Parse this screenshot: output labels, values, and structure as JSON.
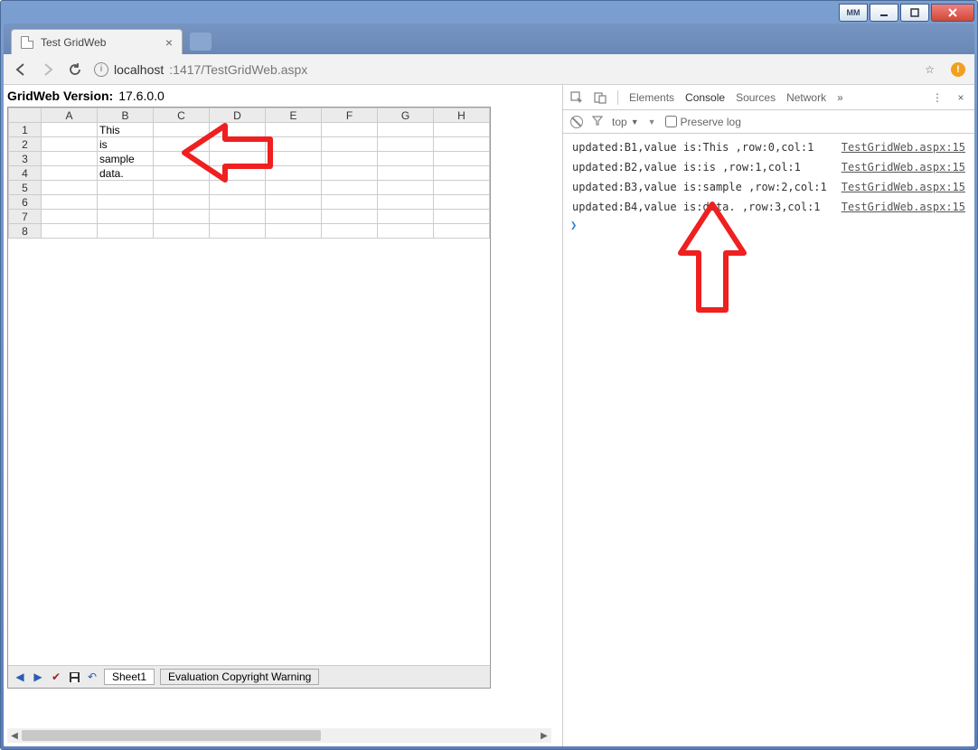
{
  "window": {
    "user_badge": "MM"
  },
  "browser": {
    "tab_title": "Test GridWeb",
    "url_host": "localhost",
    "url_port_path": ":1417/TestGridWeb.aspx"
  },
  "page": {
    "version_label": "GridWeb Version:",
    "version_value": "17.6.0.0"
  },
  "grid": {
    "columns": [
      "A",
      "B",
      "C",
      "D",
      "E",
      "F",
      "G",
      "H"
    ],
    "rows": [
      {
        "num": "1",
        "cells": [
          "",
          "This",
          "",
          "",
          "",
          "",
          "",
          ""
        ]
      },
      {
        "num": "2",
        "cells": [
          "",
          "is",
          "",
          "",
          "",
          "",
          "",
          ""
        ]
      },
      {
        "num": "3",
        "cells": [
          "",
          "sample",
          "",
          "",
          "",
          "",
          "",
          ""
        ]
      },
      {
        "num": "4",
        "cells": [
          "",
          "data.",
          "",
          "",
          "",
          "",
          "",
          ""
        ]
      },
      {
        "num": "5",
        "cells": [
          "",
          "",
          "",
          "",
          "",
          "",
          "",
          ""
        ]
      },
      {
        "num": "6",
        "cells": [
          "",
          "",
          "",
          "",
          "",
          "",
          "",
          ""
        ]
      },
      {
        "num": "7",
        "cells": [
          "",
          "",
          "",
          "",
          "",
          "",
          "",
          ""
        ]
      },
      {
        "num": "8",
        "cells": [
          "",
          "",
          "",
          "",
          "",
          "",
          "",
          ""
        ]
      }
    ],
    "sheet_tab": "Sheet1",
    "eval_tab": "Evaluation Copyright Warning"
  },
  "devtools": {
    "tabs": {
      "elements": "Elements",
      "console": "Console",
      "sources": "Sources",
      "network": "Network"
    },
    "subbar": {
      "context": "top",
      "preserve": "Preserve log"
    },
    "console": [
      {
        "msg": "updated:B1,value is:This ,row:0,col:1",
        "src": "TestGridWeb.aspx:15"
      },
      {
        "msg": "updated:B2,value is:is ,row:1,col:1",
        "src": "TestGridWeb.aspx:15"
      },
      {
        "msg": "updated:B3,value is:sample ,row:2,col:1",
        "src": "TestGridWeb.aspx:15"
      },
      {
        "msg": "updated:B4,value is:data. ,row:3,col:1",
        "src": "TestGridWeb.aspx:15"
      }
    ]
  }
}
